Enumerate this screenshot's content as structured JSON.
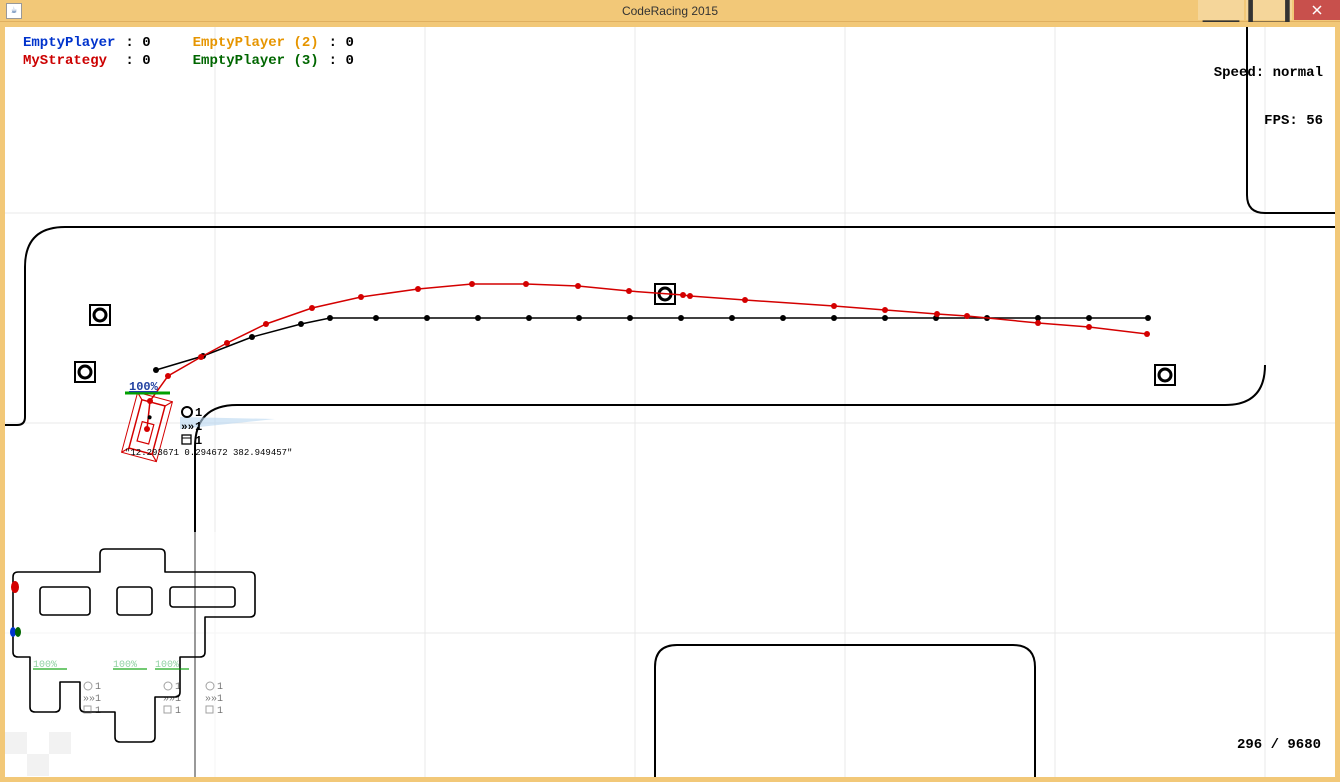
{
  "window": {
    "title": "CodeRacing 2015",
    "java_icon_label": "☕"
  },
  "hud": {
    "players": [
      {
        "name": "EmptyPlayer",
        "score": "0",
        "color": "c-blue"
      },
      {
        "name": "MyStrategy",
        "score": "0",
        "color": "c-red"
      },
      {
        "name": "EmptyPlayer (2)",
        "score": "0",
        "color": "c-orange"
      },
      {
        "name": "EmptyPlayer (3)",
        "score": "0",
        "color": "c-green"
      }
    ],
    "speed_label": "Speed:",
    "speed_value": "normal",
    "fps_label": "FPS:",
    "fps_value": "56"
  },
  "tick": {
    "current": "296",
    "total": "9680"
  },
  "car": {
    "health_label": "100%",
    "ammo": {
      "tires": "1",
      "nitro": "1",
      "oil": "1"
    },
    "debug_text": "\"12.293671 0.294672 382.949457\""
  },
  "minimap": {
    "health_labels": [
      "100%",
      "100%",
      "100%"
    ],
    "ammo_labels": [
      "1",
      "1",
      "1",
      "1",
      "1",
      "1",
      "1",
      "1",
      "1"
    ]
  },
  "track": {
    "black_waypoints": [
      [
        151,
        343
      ],
      [
        198,
        329
      ],
      [
        247,
        310
      ],
      [
        296,
        297
      ],
      [
        325,
        291
      ],
      [
        371,
        291
      ],
      [
        422,
        291
      ],
      [
        473,
        291
      ],
      [
        524,
        291
      ],
      [
        574,
        291
      ],
      [
        625,
        291
      ],
      [
        676,
        291
      ],
      [
        727,
        291
      ],
      [
        778,
        291
      ],
      [
        829,
        291
      ],
      [
        880,
        291
      ],
      [
        931,
        291
      ],
      [
        982,
        291
      ],
      [
        1033,
        291
      ],
      [
        1084,
        291
      ],
      [
        1143,
        291
      ]
    ],
    "red_waypoints": [
      [
        142,
        402
      ],
      [
        145,
        374
      ],
      [
        163,
        349
      ],
      [
        196,
        330
      ],
      [
        222,
        316
      ],
      [
        261,
        297
      ],
      [
        307,
        281
      ],
      [
        356,
        270
      ],
      [
        413,
        262
      ],
      [
        467,
        257
      ],
      [
        521,
        257
      ],
      [
        573,
        259
      ],
      [
        624,
        264
      ],
      [
        678,
        268
      ],
      [
        685,
        269
      ],
      [
        740,
        273
      ],
      [
        829,
        279
      ],
      [
        880,
        283
      ],
      [
        932,
        287
      ],
      [
        962,
        289
      ],
      [
        1033,
        296
      ],
      [
        1084,
        300
      ],
      [
        1142,
        307
      ]
    ]
  }
}
